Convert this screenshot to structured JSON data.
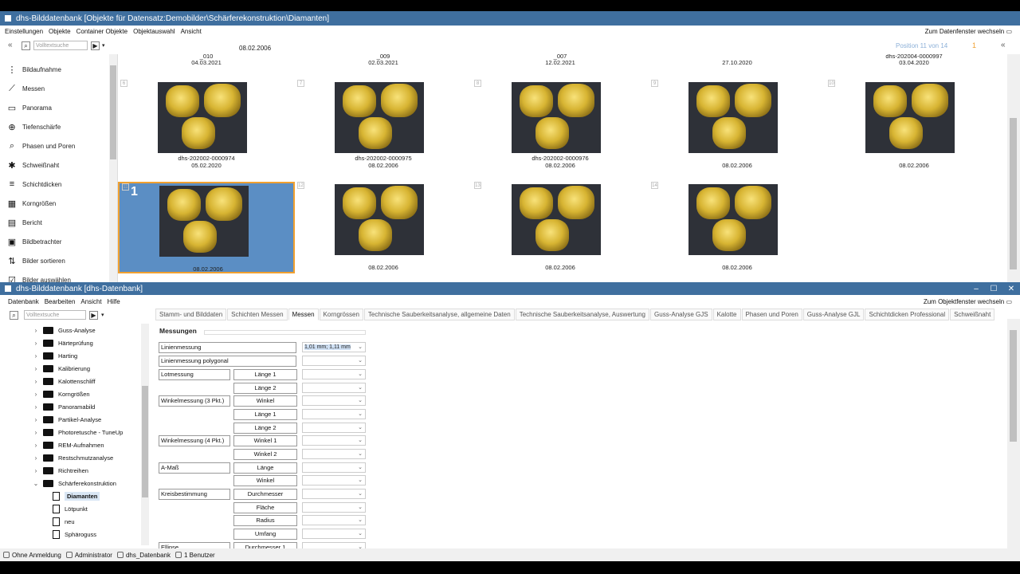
{
  "top_window": {
    "title": "dhs-Bilddatenbank [Objekte für Datensatz:Demobilder\\Schärferekonstruktion\\Diamanten]",
    "menu": [
      "Einstellungen",
      "Objekte",
      "Container Objekte",
      "Objektauswahl",
      "Ansicht"
    ],
    "switch_label": "Zum Datenfenster wechseln",
    "search_placeholder": "Volltextsuche",
    "toolbar_date": "08.02.2006",
    "position_text": "Position 11 von 14",
    "count_badge": "1"
  },
  "sidebar_items": [
    {
      "label": "Bildaufnahme",
      "icon": "tree-icon"
    },
    {
      "label": "Messen",
      "icon": "ruler-icon"
    },
    {
      "label": "Panorama",
      "icon": "panorama-icon"
    },
    {
      "label": "Tiefenschärfe",
      "icon": "depth-icon"
    },
    {
      "label": "Phasen und Poren",
      "icon": "magnifier-icon"
    },
    {
      "label": "Schweißnaht",
      "icon": "weld-icon"
    },
    {
      "label": "Schichtdicken",
      "icon": "layer-icon"
    },
    {
      "label": "Korngrößen",
      "icon": "grain-icon"
    },
    {
      "label": "Bericht",
      "icon": "report-icon"
    },
    {
      "label": "Bildbetrachter",
      "icon": "image-icon"
    },
    {
      "label": "Bilder sortieren",
      "icon": "sort-icon"
    },
    {
      "label": "Bilder auswählen",
      "icon": "select-icon"
    }
  ],
  "top_row": [
    {
      "line1": "_010",
      "line2": "04.03.2021"
    },
    {
      "line1": "_009",
      "line2": "02.03.2021"
    },
    {
      "line1": "_007",
      "line2": "12.02.2021"
    },
    {
      "line1": "",
      "line2": "27.10.2020"
    },
    {
      "line1": "dhs-202004-0000997",
      "line2": "03.04.2020"
    }
  ],
  "cells": [
    {
      "num": "6",
      "line1": "dhs-202002-0000974",
      "line2": "05.02.2020"
    },
    {
      "num": "7",
      "line1": "dhs-202002-0000975",
      "line2": "08.02.2006"
    },
    {
      "num": "8",
      "line1": "dhs-202002-0000976",
      "line2": "08.02.2006"
    },
    {
      "num": "9",
      "line1": "",
      "line2": "08.02.2006"
    },
    {
      "num": "10",
      "line1": "",
      "line2": "08.02.2006"
    },
    {
      "num": "11",
      "big": "1",
      "line1": "",
      "line2": "08.02.2006"
    },
    {
      "num": "12",
      "line1": "",
      "line2": "08.02.2006"
    },
    {
      "num": "13",
      "line1": "",
      "line2": "08.02.2006"
    },
    {
      "num": "14",
      "line1": "",
      "line2": "08.02.2006"
    }
  ],
  "bottom_window": {
    "title": "dhs-Bilddatenbank    [dhs-Datenbank]",
    "menu": [
      "Datenbank",
      "Bearbeiten",
      "Ansicht",
      "Hilfe"
    ],
    "switch_label": "Zum Objektfenster wechseln",
    "search_placeholder": "Volltextsuche"
  },
  "tabs": [
    "Stamm- und Bilddaten",
    "Schichten Messen",
    "Messen",
    "Korngrössen",
    "Technische Sauberkeitsanalyse, allgemeine Daten",
    "Technische Sauberkeitsanalyse, Auswertung",
    "Guss-Analyse GJS",
    "Kalotte",
    "Phasen und Poren",
    "Guss-Analyse GJL",
    "Schichtdicken Professional",
    "Schweißnaht"
  ],
  "tree": [
    {
      "label": "Guss-Analyse",
      "type": "folder"
    },
    {
      "label": "Härteprüfung",
      "type": "folder"
    },
    {
      "label": "Harting",
      "type": "folder"
    },
    {
      "label": "Kalibrierung",
      "type": "folder"
    },
    {
      "label": "Kalottenschliff",
      "type": "folder"
    },
    {
      "label": "Korngrößen",
      "type": "folder"
    },
    {
      "label": "Panoramabild",
      "type": "folder"
    },
    {
      "label": "Partikel-Analyse",
      "type": "folder"
    },
    {
      "label": "Photoretusche - TuneUp",
      "type": "folder"
    },
    {
      "label": "REM-Aufnahmen",
      "type": "folder"
    },
    {
      "label": "Restschmutzanalyse",
      "type": "folder"
    },
    {
      "label": "Richtreihen",
      "type": "folder"
    },
    {
      "label": "Schärferekonstruktion",
      "type": "folder-open"
    },
    {
      "label": "Diamanten",
      "type": "doc-selected"
    },
    {
      "label": "Lötpunkt",
      "type": "doc"
    },
    {
      "label": "neu",
      "type": "doc"
    },
    {
      "label": "Sphäroguss",
      "type": "doc"
    }
  ],
  "measure": {
    "section_title": "Messungen",
    "linienmessung": "Linienmessung",
    "linienmessung_value": "1,01 mm; 1,11 mm",
    "linienmessung_polygonal": "Linienmessung polygonal",
    "lotmessung": "Lotmessung",
    "winkel3": "Winkelmessung (3 Pkt.)",
    "winkel4": "Winkelmessung (4 Pkt.)",
    "amass": "A-Maß",
    "kreis": "Kreisbestimmung",
    "ellipse": "Ellipse",
    "sub": [
      "Länge 1",
      "Länge 2",
      "Winkel",
      "Länge 1",
      "Länge 2",
      "Winkel 1",
      "Winkel 2",
      "Länge",
      "Winkel",
      "Durchmesser",
      "Fläche",
      "Radius",
      "Umfang",
      "Durchmesser 1"
    ]
  },
  "status": [
    "Ohne Anmeldung",
    "Administrator",
    "dhs_Datenbank",
    "1 Benutzer"
  ]
}
